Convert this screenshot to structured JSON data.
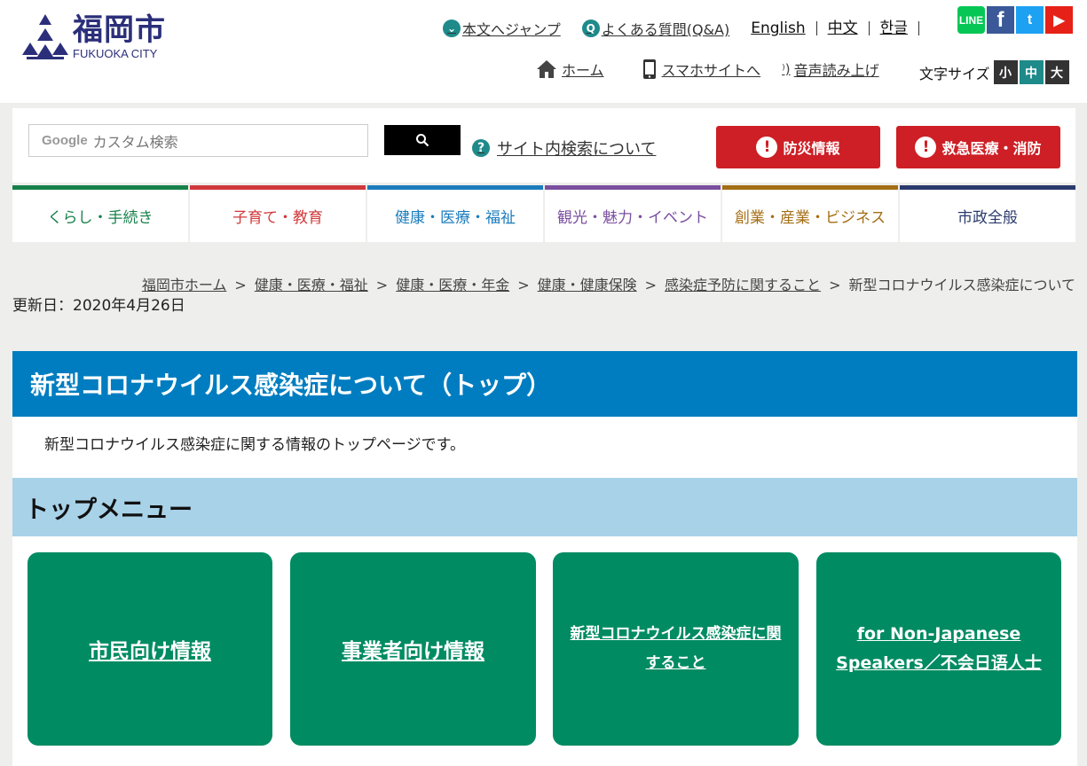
{
  "logo": {
    "kanji": "福岡市",
    "english": "FUKUOKA CITY"
  },
  "header": {
    "jump_label": "本文へジャンプ",
    "faq_label": "よくある質問(Q&A)",
    "languages": [
      "English",
      "中文",
      "한글"
    ],
    "social": {
      "line": "LINE",
      "facebook": "f",
      "twitter": "t",
      "youtube": "▶"
    },
    "home_label": "ホーム",
    "smartphone_label": "スマホサイトへ",
    "voice_label": "音声読み上げ",
    "fontsize_label": "文字サイズ",
    "fontsize_options": [
      "小",
      "中",
      "大"
    ]
  },
  "search": {
    "google_label": "Google",
    "placeholder": "カスタム検索",
    "help_label": "サイト内検索について"
  },
  "emergency": {
    "disaster_label": "防災情報",
    "medical_label": "救急医療・消防"
  },
  "nav": [
    {
      "label": "くらし・手続き",
      "color": "#17814a"
    },
    {
      "label": "子育て・教育",
      "color": "#d0383a"
    },
    {
      "label": "健康・医療・福祉",
      "color": "#1b7cbd"
    },
    {
      "label": "観光・魅力・イベント",
      "color": "#7b4fa0"
    },
    {
      "label": "創業・産業・ビジネス",
      "color": "#a46e14"
    },
    {
      "label": "市政全般",
      "color": "#2b3a6e"
    }
  ],
  "breadcrumb": {
    "links": [
      "福岡市ホーム",
      "健康・医療・福祉",
      "健康・医療・年金",
      "健康・健康保険",
      "感染症予防に関すること"
    ],
    "current": "新型コロナウイルス感染症について",
    "separator": ">"
  },
  "updated": "更新日：2020年4月26日",
  "page_title": "新型コロナウイルス感染症について（トップ）",
  "lead": "新型コロナウイルス感染症に関する情報のトップページです。",
  "menu_heading": "トップメニュー",
  "cards": [
    {
      "label": "市民向け情報"
    },
    {
      "label": "事業者向け情報"
    },
    {
      "label": "新型コロナウイルス感染症に関すること"
    },
    {
      "label": "for Non-Japanese Speakers／不会日语人士"
    }
  ],
  "colors": {
    "title_bar": "#007dc0",
    "menu_head": "#a8d2e8",
    "card": "#008b62",
    "emergency": "#cd1f25",
    "accent_teal": "#1f8a8a"
  }
}
